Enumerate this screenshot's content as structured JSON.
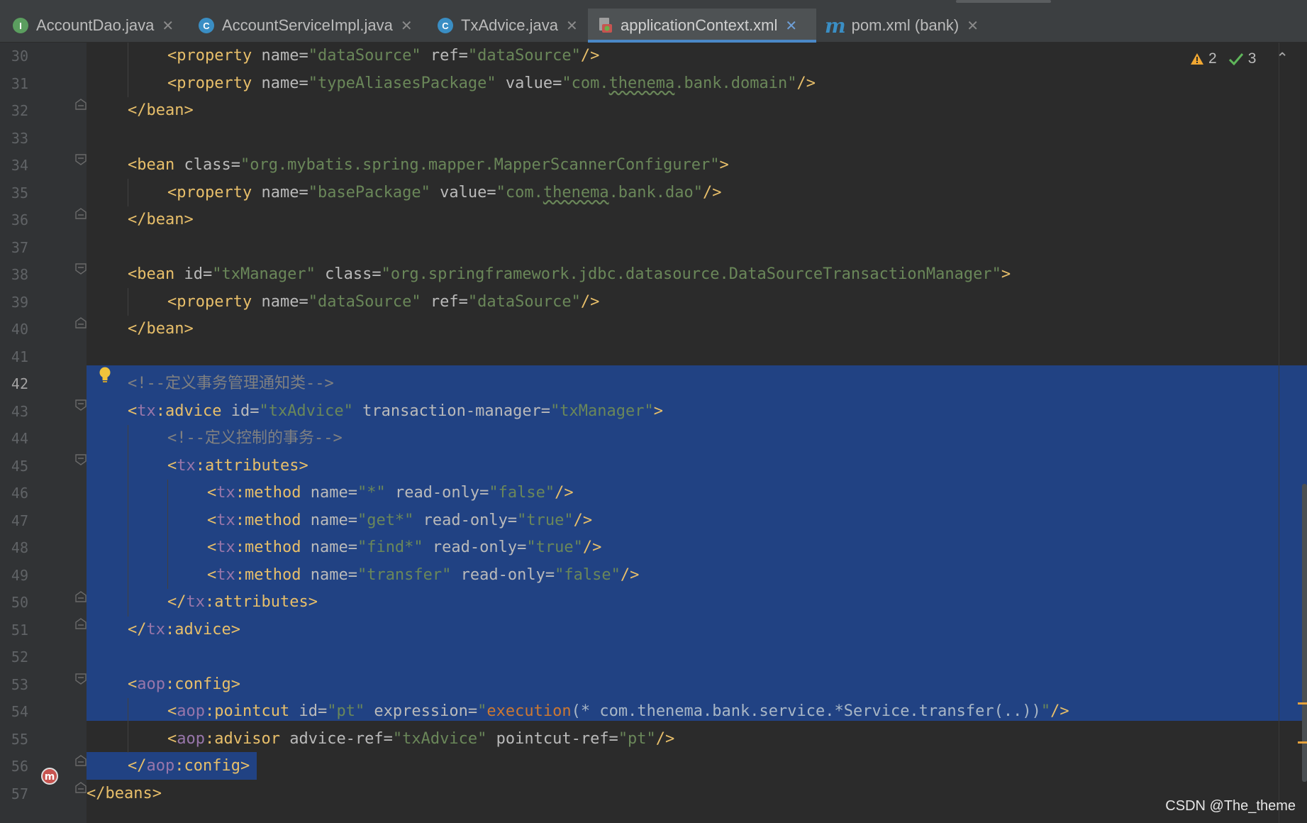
{
  "tabs": [
    {
      "label": "AccountDao.java",
      "icon": "interface-icon",
      "icon_letter": "I",
      "icon_color": "#5b9e5f"
    },
    {
      "label": "AccountServiceImpl.java",
      "icon": "class-icon",
      "icon_letter": "C",
      "icon_color": "#3a8ec4"
    },
    {
      "label": "TxAdvice.java",
      "icon": "class-icon",
      "icon_letter": "C",
      "icon_color": "#3a8ec4"
    },
    {
      "label": "applicationContext.xml",
      "icon": "xml-file-icon",
      "active": true
    },
    {
      "label": "pom.xml (bank)",
      "icon": "maven-icon",
      "icon_letter": "m"
    }
  ],
  "inspections": {
    "warnings": "2",
    "checks": "3"
  },
  "line_numbers": [
    "30",
    "31",
    "32",
    "33",
    "34",
    "35",
    "36",
    "37",
    "38",
    "39",
    "40",
    "41",
    "42",
    "43",
    "44",
    "45",
    "46",
    "47",
    "48",
    "49",
    "50",
    "51",
    "52",
    "53",
    "54",
    "55",
    "56",
    "57"
  ],
  "code": {
    "l30": {
      "t1": "<property",
      "a1": " name=",
      "v1": "\"dataSource\"",
      "a2": " ref=",
      "v2": "\"dataSource\"",
      "t2": "/>"
    },
    "l31": {
      "t1": "<property",
      "a1": " name=",
      "v1": "\"typeAliasesPackage\"",
      "a2": " value=",
      "v2a": "\"com.",
      "v2b": "thenema",
      "v2c": ".bank.domain\"",
      "t2": "/>"
    },
    "l32": {
      "t1": "</bean>"
    },
    "l34": {
      "t1": "<bean",
      "a1": " class=",
      "v1": "\"org.mybatis.spring.mapper.MapperScannerConfigurer\"",
      "t2": ">"
    },
    "l35": {
      "t1": "<property",
      "a1": " name=",
      "v1": "\"basePackage\"",
      "a2": " value=",
      "v2a": "\"com.",
      "v2b": "thenema",
      "v2c": ".bank.dao\"",
      "t2": "/>"
    },
    "l36": {
      "t1": "</bean>"
    },
    "l38": {
      "t1": "<bean",
      "a1": " id=",
      "v1": "\"txManager\"",
      "a2": " class=",
      "v2": "\"org.springframework.jdbc.datasource.DataSourceTransactionManager\"",
      "t2": ">"
    },
    "l39": {
      "t1": "<property",
      "a1": " name=",
      "v1": "\"dataSource\"",
      "a2": " ref=",
      "v2": "\"dataSource\"",
      "t2": "/>"
    },
    "l40": {
      "t1": "</bean>"
    },
    "l42": {
      "c": "<!--定义事务管理通知类-->"
    },
    "l43": {
      "t0": "<",
      "ns": "tx",
      "t1": ":advice",
      "a1": " id=",
      "v1": "\"txAdvice\"",
      "a2": " transaction-manager=",
      "v2": "\"txManager\"",
      "t2": ">"
    },
    "l44": {
      "c": "<!--定义控制的事务-->"
    },
    "l45": {
      "t0": "<",
      "ns": "tx",
      "t1": ":attributes>"
    },
    "l46": {
      "t0": "<",
      "ns": "tx",
      "t1": ":method",
      "a1": " name=",
      "v1": "\"*\"",
      "a2": " read-only=",
      "v2": "\"false\"",
      "t2": "/>"
    },
    "l47": {
      "t0": "<",
      "ns": "tx",
      "t1": ":method",
      "a1": " name=",
      "v1": "\"get*\"",
      "a2": " read-only=",
      "v2": "\"true\"",
      "t2": "/>"
    },
    "l48": {
      "t0": "<",
      "ns": "tx",
      "t1": ":method",
      "a1": " name=",
      "v1": "\"find*\"",
      "a2": " read-only=",
      "v2": "\"true\"",
      "t2": "/>"
    },
    "l49": {
      "t0": "<",
      "ns": "tx",
      "t1": ":method",
      "a1": " name=",
      "v1": "\"transfer\"",
      "a2": " read-only=",
      "v2": "\"false\"",
      "t2": "/>"
    },
    "l50": {
      "t0": "</",
      "ns": "tx",
      "t1": ":attributes>"
    },
    "l51": {
      "t0": "</",
      "ns": "tx",
      "t1": ":advice>"
    },
    "l53": {
      "t0": "<",
      "ns": "aop",
      "t1": ":config>"
    },
    "l54": {
      "t0": "<",
      "ns": "aop",
      "t1": ":pointcut",
      "a1": " id=",
      "v1": "\"pt\"",
      "a2": " expression=",
      "v2a": "\"",
      "ex": "execution",
      "pl": "(* com.thenema.bank.service.*Service.transfer(..))",
      "v2b": "\"",
      "t2": "/>"
    },
    "l55": {
      "t0": "<",
      "ns": "aop",
      "t1": ":advisor",
      "a1": " advice-ref=",
      "v1": "\"txAdvice\"",
      "a2": " pointcut-ref=",
      "v2": "\"pt\"",
      "t2": "/>"
    },
    "l56": {
      "t0": "</",
      "ns": "aop",
      "t1": ":config>"
    },
    "l57": {
      "t1": "</beans>"
    }
  },
  "watermark": "CSDN @The_theme",
  "colors": {
    "selection": "#214283",
    "tag": "#e8bf6a",
    "attr": "#bababa",
    "value": "#6a8759",
    "comment": "#808080",
    "namespace": "#9876aa"
  }
}
